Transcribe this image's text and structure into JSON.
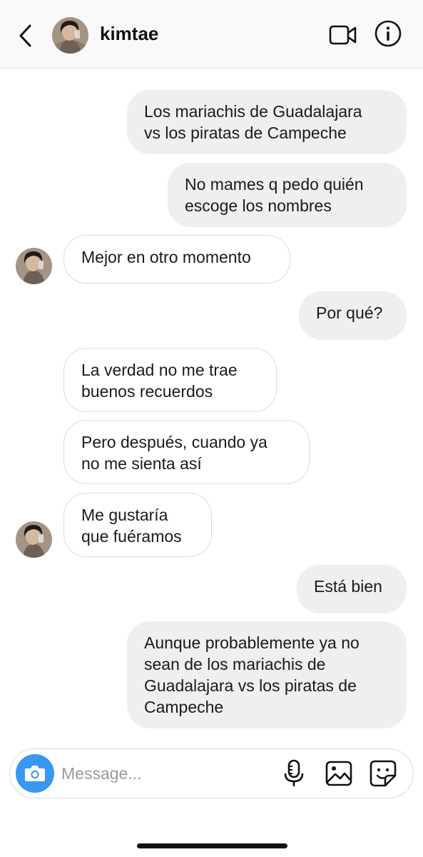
{
  "header": {
    "username": "kimtae",
    "icons": {
      "back": "chevron-left-icon",
      "video": "video-call-icon",
      "info": "info-icon"
    }
  },
  "messages": [
    {
      "direction": "outgoing",
      "lines": [
        "Los mariachis de Guadalajara",
        "vs los piratas de Campeche"
      ]
    },
    {
      "direction": "outgoing",
      "lines": [
        "No mames q pedo quién",
        "escoge los nombres"
      ]
    },
    {
      "direction": "incoming",
      "lines": [
        "Mejor en otro momento"
      ],
      "avatar": true
    },
    {
      "direction": "outgoing",
      "lines": [
        "Por qué?"
      ]
    },
    {
      "direction": "incoming",
      "lines": [
        "La verdad no me trae",
        "buenos recuerdos"
      ]
    },
    {
      "direction": "incoming",
      "lines": [
        "Pero después, cuando ya",
        "no me sienta así"
      ]
    },
    {
      "direction": "incoming",
      "lines": [
        "Me gustaría",
        "que fuéramos"
      ],
      "avatar": true
    },
    {
      "direction": "outgoing",
      "lines": [
        "Está bien"
      ]
    },
    {
      "direction": "outgoing",
      "lines": [
        "Aunque probablemente ya no",
        "sean de los mariachis de",
        "Guadalajara vs los piratas de",
        "Campeche"
      ]
    }
  ],
  "composer": {
    "placeholder": "Message...",
    "icons": {
      "camera": "camera-icon",
      "mic": "microphone-icon",
      "gallery": "gallery-icon",
      "sticker": "sticker-icon"
    }
  },
  "colors": {
    "accent": "#3897f0",
    "outgoing_bubble": "#efefef",
    "incoming_border": "#dbdbdb"
  }
}
